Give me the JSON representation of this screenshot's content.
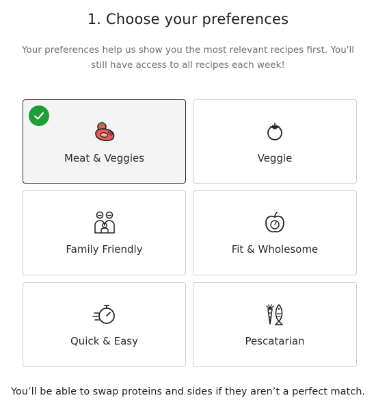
{
  "header": {
    "title": "1. Choose your preferences",
    "subtitle": "Your preferences help us show you the most relevant recipes first. You'll still have access to all recipes each week!"
  },
  "preferences": [
    {
      "label": "Meat & Veggies",
      "icon": "steak-tomato-icon",
      "selected": true
    },
    {
      "label": "Veggie",
      "icon": "tomato-icon",
      "selected": false
    },
    {
      "label": "Family Friendly",
      "icon": "family-icon",
      "selected": false
    },
    {
      "label": "Fit & Wholesome",
      "icon": "apple-scale-icon",
      "selected": false
    },
    {
      "label": "Quick & Easy",
      "icon": "stopwatch-icon",
      "selected": false
    },
    {
      "label": "Pescatarian",
      "icon": "fish-carrot-icon",
      "selected": false
    }
  ],
  "footer": {
    "note": "You’ll be able to swap proteins and sides if they aren’t a perfect match."
  },
  "colors": {
    "selected_check": "#1f9d38",
    "selected_border": "#2e2e2e",
    "card_border": "#cfcfcf",
    "steak_red": "#e8595a",
    "leaf_green": "#2f9e44"
  }
}
